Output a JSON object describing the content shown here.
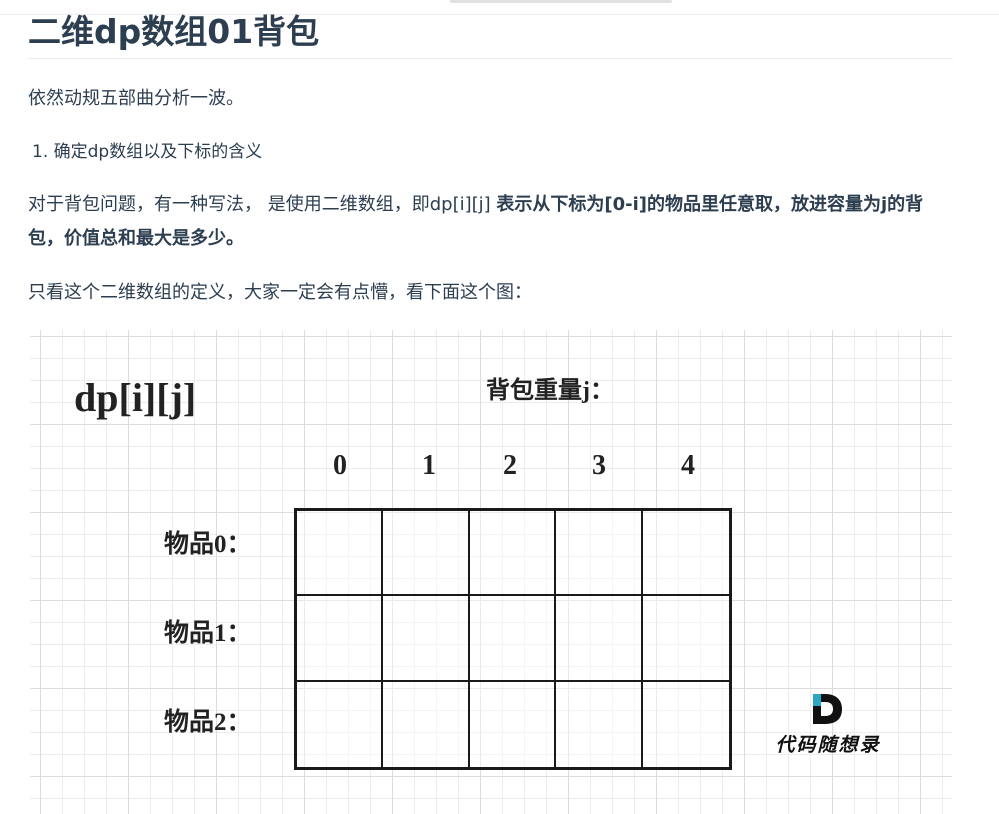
{
  "heading": "二维dp数组01背包",
  "paragraphs": {
    "intro": "依然动规五部曲分析一波。",
    "step1_num": "1.",
    "step1_text": "确定dp数组以及下标的含义",
    "def_a": "对于背包问题，有一种写法， 是使用二维数组，即dp[i][j] ",
    "def_b": "表示从下标为[0-i]的物品里任意取，放进容量为j的背包，价值总和最大是多少。",
    "look": "只看这个二维数组的定义，大家一定会有点懵，看下面这个图："
  },
  "figure": {
    "dp_label": "dp[i][j]",
    "weight_label": "背包重量j：",
    "columns": [
      "0",
      "1",
      "2",
      "3",
      "4"
    ],
    "rows": [
      "物品0：",
      "物品1：",
      "物品2："
    ],
    "logo_text": "代码随想录",
    "logo_letter": "D"
  }
}
